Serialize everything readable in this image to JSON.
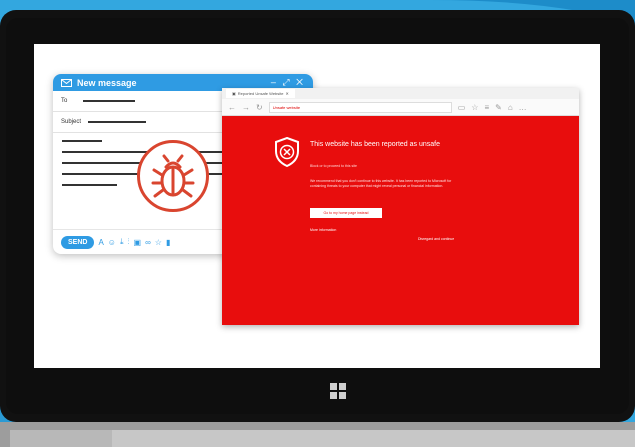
{
  "compose": {
    "title": "New message",
    "window_controls": "– ⤢ ✕",
    "to_label": "To",
    "subject_label": "Subject",
    "send_label": "SEND",
    "toolbar_icons": [
      "font-icon",
      "emoji-icon",
      "attach-icon",
      "attach-alt-icon",
      "image-icon",
      "link-icon",
      "star-icon",
      "trash-icon"
    ]
  },
  "browser": {
    "tab_title": "Reported Unsafe Website",
    "url_label": "Unsafe website",
    "warning_title": "This website has been reported as unsafe",
    "warning_subtitle": "Block or to proceed to this site",
    "warning_text": "We recommend that you don't continue to this website. It has been reported to Microsoft for containing threats to your computer that might reveal personal or financial information.",
    "go_home_label": "Go to my home page instead",
    "more_info_label": "More information",
    "disregard_label": "Disregard and continue"
  },
  "colors": {
    "accent": "#2f9be3",
    "danger": "#e80d0d",
    "bug": "#d9452f"
  }
}
